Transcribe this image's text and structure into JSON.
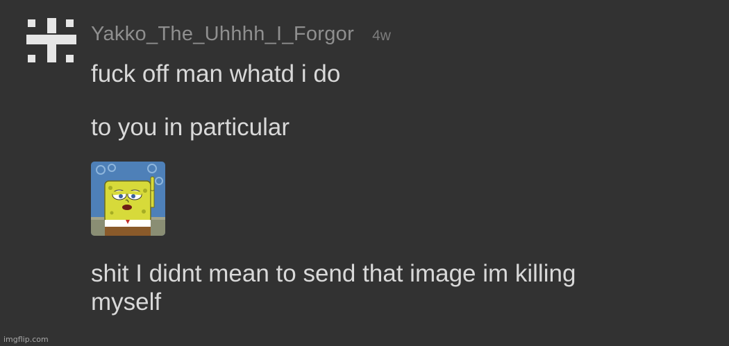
{
  "comment": {
    "avatar_icon": "pixel-pattern-avatar-icon",
    "username": "Yakko_The_Uhhhh_I_Forgor",
    "timestamp": "4w",
    "messages": [
      "fuck off man whatd i do",
      "to you in particular"
    ],
    "sticker_icon": "spongebob-sticker-image",
    "message_after_image": [
      "shit I didnt mean to send that image im killing",
      "myself"
    ]
  },
  "watermark": "imgflip.com",
  "colors": {
    "background": "#323232",
    "username": "#8f8f8f",
    "timestamp": "#7c7c7c",
    "message_text": "#d9d9d9"
  }
}
